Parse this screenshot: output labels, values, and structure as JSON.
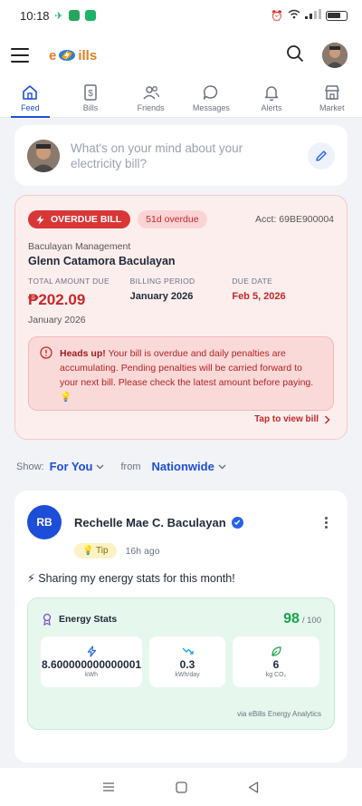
{
  "status_bar": {
    "time": "10:18"
  },
  "header": {
    "logo_text": "eBills",
    "logo_left": "e",
    "logo_right": "ills"
  },
  "tabs": [
    {
      "label": "Feed",
      "icon": "home-icon",
      "active": true
    },
    {
      "label": "Bills",
      "icon": "bill-icon",
      "active": false
    },
    {
      "label": "Friends",
      "icon": "friends-icon",
      "active": false
    },
    {
      "label": "Messages",
      "icon": "message-icon",
      "active": false
    },
    {
      "label": "Alerts",
      "icon": "bell-icon",
      "active": false
    },
    {
      "label": "Market",
      "icon": "store-icon",
      "active": false
    }
  ],
  "composer": {
    "placeholder": "What's on your mind about your electricity bill?"
  },
  "overdue": {
    "badge": "OVERDUE BILL",
    "days": "51d overdue",
    "account": "Acct: 69BE900004",
    "company": "Baculayan Management",
    "name": "Glenn Catamora Baculayan",
    "total_label": "TOTAL AMOUNT DUE",
    "total_amount": "₱202.09",
    "total_month": "January 2026",
    "period_label": "BILLING PERIOD",
    "period_value": "January 2026",
    "due_label": "DUE DATE",
    "due_value": "Feb 5, 2026",
    "alert_heading": "Heads up!",
    "alert_text": "Your bill is overdue and daily penalties are accumulating. Pending penalties will be carried forward to your next bill. Please check the latest amount before paying. 💡",
    "link": "Tap to view bill"
  },
  "filter": {
    "show_label": "Show:",
    "show_value": "For You",
    "from_label": "from",
    "from_value": "Nationwide"
  },
  "post": {
    "initials": "RB",
    "author": "Rechelle Mae C. Baculayan",
    "tag": "💡 Tip",
    "time": "16h ago",
    "body": "⚡ Sharing my energy stats for this month!",
    "energy_title": "Energy Stats",
    "score": "98",
    "score_max": "/ 100",
    "stats": [
      {
        "value": "8.600000000000001",
        "unit": "kWh",
        "icon": "bolt-icon"
      },
      {
        "value": "0.3",
        "unit": "kWh/day",
        "icon": "trend-down-icon"
      },
      {
        "value": "6",
        "unit": "kg CO₂",
        "icon": "leaf-icon"
      }
    ],
    "footer": "via eBills Energy Analytics"
  }
}
